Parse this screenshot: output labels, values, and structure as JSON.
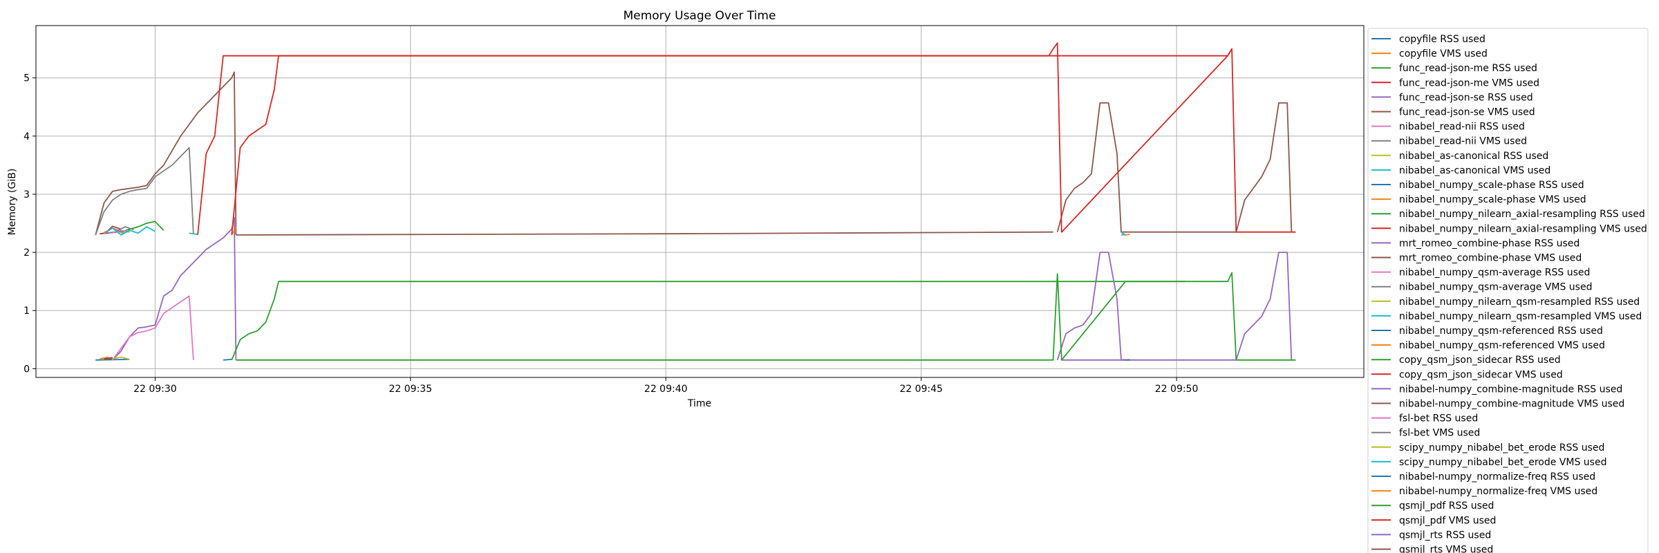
{
  "chart_data": {
    "type": "line",
    "title": "Memory Usage Over Time",
    "xlabel": "Time",
    "ylabel": "Memory (GiB)",
    "xlim": [
      "2022-xx-22 09:27:40",
      "2022-xx-22 09:53:40"
    ],
    "ylim": [
      -0.15,
      5.9
    ],
    "x_ticks": [
      "22 09:30",
      "22 09:35",
      "22 09:40",
      "22 09:45",
      "22 09:50"
    ],
    "y_ticks": [
      "0",
      "1",
      "2",
      "3",
      "4",
      "5"
    ],
    "grid": true,
    "legend_position": "right, outside plot area",
    "series": [
      {
        "name": "copyfile RSS used",
        "color": "#1f77b4",
        "x": [
          "09:28:55",
          "09:29:00"
        ],
        "y": [
          2.32,
          2.33
        ]
      },
      {
        "name": "copyfile VMS used",
        "color": "#ff7f0e",
        "x": [
          "09:29:00",
          "09:29:10",
          "09:29:20"
        ],
        "y": [
          2.34,
          2.42,
          2.36
        ]
      },
      {
        "name": "func_read-json-me RSS used",
        "color": "#2ca02c",
        "x": [
          "09:29:20",
          "09:29:30",
          "09:29:40",
          "09:29:50",
          "09:30:00",
          "09:30:10"
        ],
        "y": [
          2.35,
          2.4,
          2.44,
          2.5,
          2.53,
          2.38
        ]
      },
      {
        "name": "func_read-json-me VMS used",
        "color": "#d62728",
        "x": [
          "09:28:55",
          "09:29:10",
          "09:29:20"
        ],
        "y": [
          2.32,
          2.34,
          2.36
        ]
      },
      {
        "name": "func_read-json-se RSS used",
        "color": "#9467bd",
        "x": [
          "09:29:05",
          "09:29:15",
          "09:29:25"
        ],
        "y": [
          2.33,
          2.36,
          2.34
        ]
      },
      {
        "name": "func_read-json-se VMS used",
        "color": "#8c564b",
        "x": [
          "09:29:05",
          "09:29:10",
          "09:29:20"
        ],
        "y": [
          2.38,
          2.45,
          2.4
        ]
      },
      {
        "name": "nibabel_read-nii RSS used",
        "color": "#e377c2",
        "x": [
          "09:29:10",
          "09:29:20",
          "09:29:30"
        ],
        "y": [
          2.34,
          2.38,
          2.35
        ]
      },
      {
        "name": "nibabel_read-nii VMS used",
        "color": "#7f7f7f",
        "x": [
          "09:29:15",
          "09:29:25",
          "09:29:35"
        ],
        "y": [
          2.37,
          2.44,
          2.39
        ]
      },
      {
        "name": "nibabel_as-canonical RSS used",
        "color": "#bcbd22",
        "x": [
          "09:29:20",
          "09:29:30"
        ],
        "y": [
          2.33,
          2.36
        ]
      },
      {
        "name": "nibabel_as-canonical VMS used",
        "color": "#17becf",
        "x": [
          "09:29:00",
          "09:29:10",
          "09:29:20",
          "09:29:30",
          "09:29:40",
          "09:29:50",
          "09:30:00"
        ],
        "y": [
          2.32,
          2.42,
          2.3,
          2.38,
          2.33,
          2.44,
          2.36
        ]
      },
      {
        "name": "nibabel_numpy_scale-phase RSS used",
        "color": "#1f77b4",
        "x": [
          "09:28:50",
          "09:29:30"
        ],
        "y": [
          0.15,
          0.16
        ]
      },
      {
        "name": "nibabel_numpy_scale-phase VMS used",
        "color": "#ff7f0e",
        "x": [
          "09:28:55",
          "09:29:05"
        ],
        "y": [
          0.17,
          0.2
        ]
      },
      {
        "name": "nibabel_numpy_nilearn_axial-resampling RSS used",
        "color": "#2ca02c",
        "x": [
          "09:29:00",
          "09:29:10"
        ],
        "y": [
          0.16,
          0.18
        ]
      },
      {
        "name": "nibabel_numpy_nilearn_axial-resampling VMS used",
        "color": "#d62728",
        "x": [
          "09:29:00",
          "09:29:10"
        ],
        "y": [
          0.17,
          0.19
        ]
      },
      {
        "name": "mrt_romeo_combine-phase RSS used",
        "color": "#9467bd",
        "x": [
          "09:29:10",
          "09:29:20",
          "09:29:30",
          "09:29:40",
          "09:29:50",
          "09:30:00",
          "09:30:10",
          "09:30:20",
          "09:30:30",
          "09:30:40",
          "09:30:50",
          "09:31:00",
          "09:31:10",
          "09:31:20",
          "09:31:30",
          "09:31:33",
          "09:31:35"
        ],
        "y": [
          0.15,
          0.3,
          0.55,
          0.7,
          0.72,
          0.75,
          1.25,
          1.35,
          1.6,
          1.75,
          1.9,
          2.05,
          2.15,
          2.25,
          2.4,
          2.6,
          0.15
        ]
      },
      {
        "name": "mrt_romeo_combine-phase VMS used",
        "color": "#8c564b",
        "x": [
          "09:28:50",
          "09:29:00",
          "09:29:10",
          "09:29:20",
          "09:29:30",
          "09:29:40",
          "09:29:50",
          "09:30:00",
          "09:30:10",
          "09:30:20",
          "09:30:30",
          "09:30:40",
          "09:30:50",
          "09:31:00",
          "09:31:10",
          "09:31:20",
          "09:31:30",
          "09:31:33",
          "09:31:35"
        ],
        "y": [
          2.3,
          2.85,
          3.05,
          3.08,
          3.1,
          3.12,
          3.15,
          3.35,
          3.5,
          3.75,
          4.0,
          4.2,
          4.4,
          4.55,
          4.7,
          4.85,
          5.0,
          5.1,
          2.3
        ]
      },
      {
        "name": "nibabel_numpy_qsm-average RSS used",
        "color": "#e377c2",
        "x": [
          "09:29:10",
          "09:29:20",
          "09:29:30",
          "09:29:40",
          "09:29:50",
          "09:30:00",
          "09:30:10",
          "09:30:20",
          "09:30:30",
          "09:30:40",
          "09:30:45"
        ],
        "y": [
          0.15,
          0.35,
          0.55,
          0.62,
          0.65,
          0.7,
          0.95,
          1.05,
          1.15,
          1.25,
          0.15
        ]
      },
      {
        "name": "nibabel_numpy_qsm-average VMS used",
        "color": "#7f7f7f",
        "x": [
          "09:28:50",
          "09:29:00",
          "09:29:10",
          "09:29:20",
          "09:29:30",
          "09:29:40",
          "09:29:50",
          "09:30:00",
          "09:30:10",
          "09:30:20",
          "09:30:30",
          "09:30:40",
          "09:30:45"
        ],
        "y": [
          2.3,
          2.7,
          2.9,
          3.0,
          3.05,
          3.08,
          3.1,
          3.3,
          3.4,
          3.5,
          3.65,
          3.8,
          2.32
        ]
      },
      {
        "name": "nibabel_numpy_nilearn_qsm-resampled RSS used",
        "color": "#bcbd22",
        "x": [
          "09:29:10",
          "09:29:20",
          "09:29:30"
        ],
        "y": [
          0.17,
          0.2,
          0.16
        ]
      },
      {
        "name": "nibabel_numpy_nilearn_qsm-resampled VMS used",
        "color": "#17becf",
        "x": [
          "09:30:40",
          "09:30:50"
        ],
        "y": [
          2.33,
          2.31
        ]
      },
      {
        "name": "nibabel_numpy_qsm-referenced RSS used",
        "color": "#1f77b4",
        "x": [
          "09:31:20",
          "09:31:30"
        ],
        "y": [
          0.15,
          0.16
        ]
      },
      {
        "name": "nibabel_numpy_qsm-referenced VMS used",
        "color": "#ff7f0e",
        "x": [
          "09:31:30",
          "09:31:35"
        ],
        "y": [
          2.3,
          2.43
        ]
      },
      {
        "name": "copy_qsm_json_sidecar RSS used",
        "color": "#2ca02c",
        "x": [
          "09:31:30",
          "09:31:40",
          "09:31:50",
          "09:32:00",
          "09:32:10",
          "09:32:20",
          "09:32:25",
          "09:50:00",
          "09:50:10"
        ],
        "y": [
          0.15,
          0.5,
          0.6,
          0.65,
          0.8,
          1.2,
          1.5,
          1.5,
          1.5
        ]
      },
      {
        "name": "copy_qsm_json_sidecar VMS used",
        "color": "#d62728",
        "x": [
          "09:31:30",
          "09:31:40",
          "09:31:50",
          "09:32:00",
          "09:32:10",
          "09:32:20",
          "09:32:25",
          "09:51:00",
          "09:51:05"
        ],
        "y": [
          2.3,
          3.8,
          4.0,
          4.1,
          4.2,
          4.8,
          5.38,
          5.38,
          5.5
        ]
      },
      {
        "name": "nibabel-numpy_combine-magnitude RSS used",
        "color": "#9467bd",
        "x": [
          "09:47:40",
          "09:47:50",
          "09:48:00",
          "09:48:10",
          "09:48:20",
          "09:48:30",
          "09:48:40",
          "09:48:50",
          "09:48:55",
          "09:49:00",
          "09:51:10",
          "09:51:20",
          "09:51:30",
          "09:51:40",
          "09:51:50",
          "09:52:00",
          "09:52:10",
          "09:52:15"
        ],
        "y": [
          0.15,
          0.6,
          0.7,
          0.75,
          0.95,
          2.0,
          2.0,
          1.2,
          0.15,
          0.15,
          0.15,
          0.6,
          0.75,
          0.9,
          1.2,
          2.0,
          2.0,
          0.15
        ]
      },
      {
        "name": "nibabel-numpy_combine-magnitude VMS used",
        "color": "#8c564b",
        "x": [
          "09:47:40",
          "09:47:50",
          "09:48:00",
          "09:48:10",
          "09:48:20",
          "09:48:30",
          "09:48:40",
          "09:48:50",
          "09:48:55",
          "09:49:00",
          "09:51:10",
          "09:51:20",
          "09:51:30",
          "09:51:40",
          "09:51:50",
          "09:52:00",
          "09:52:10",
          "09:52:15"
        ],
        "y": [
          2.35,
          2.9,
          3.1,
          3.2,
          3.35,
          4.57,
          4.57,
          3.7,
          2.35,
          2.35,
          2.35,
          2.9,
          3.1,
          3.3,
          3.6,
          4.57,
          4.57,
          2.35
        ]
      },
      {
        "name": "fsl-bet RSS used",
        "color": "#e377c2",
        "x": [
          "09:48:55",
          "09:49:00"
        ],
        "y": [
          0.15,
          0.16
        ]
      },
      {
        "name": "fsl-bet VMS used",
        "color": "#7f7f7f",
        "x": [
          "09:48:55",
          "09:49:00"
        ],
        "y": [
          2.3,
          2.31
        ]
      },
      {
        "name": "scipy_numpy_nibabel_bet_erode RSS used",
        "color": "#bcbd22",
        "x": [
          "09:49:00",
          "09:49:05"
        ],
        "y": [
          0.15,
          0.16
        ]
      },
      {
        "name": "scipy_numpy_nibabel_bet_erode VMS used",
        "color": "#17becf",
        "x": [
          "09:48:55",
          "09:49:00"
        ],
        "y": [
          2.35,
          2.29
        ]
      },
      {
        "name": "nibabel-numpy_normalize-freq RSS used",
        "color": "#1f77b4",
        "x": [
          "09:49:00",
          "09:49:05"
        ],
        "y": [
          0.15,
          0.15
        ]
      },
      {
        "name": "nibabel-numpy_normalize-freq VMS used",
        "color": "#ff7f0e",
        "x": [
          "09:49:00",
          "09:49:05"
        ],
        "y": [
          2.3,
          2.31
        ]
      },
      {
        "name": "qsmjl_pdf RSS used",
        "color": "#2ca02c",
        "x": [
          "09:31:35",
          "09:40:00",
          "09:47:35",
          "09:47:40",
          "09:47:45",
          "09:49:00",
          "09:51:00",
          "09:51:05",
          "09:51:10",
          "09:52:20"
        ],
        "y": [
          0.15,
          0.15,
          0.15,
          1.63,
          0.15,
          1.5,
          1.5,
          1.65,
          0.15,
          0.15
        ]
      },
      {
        "name": "qsmjl_pdf VMS used",
        "color": "#d62728",
        "x": [
          "09:30:50",
          "09:31:00",
          "09:31:10",
          "09:31:15",
          "09:31:20",
          "09:31:30",
          "09:40:00",
          "09:47:30",
          "09:47:35",
          "09:47:40",
          "09:47:45",
          "09:51:00",
          "09:51:05",
          "09:51:10",
          "09:52:20"
        ],
        "y": [
          2.3,
          3.7,
          4.0,
          4.7,
          5.38,
          5.38,
          5.38,
          5.38,
          5.5,
          5.6,
          2.35,
          5.38,
          5.5,
          2.35,
          2.35
        ]
      },
      {
        "name": "qsmjl_rts RSS used",
        "color": "#9467bd",
        "x": [
          "09:47:45",
          "09:49:00"
        ],
        "y": [
          0.15,
          0.15
        ]
      },
      {
        "name": "qsmjl_rts VMS used",
        "color": "#8c564b",
        "x": [
          "09:31:35",
          "09:40:00",
          "09:47:35"
        ],
        "y": [
          2.3,
          2.32,
          2.35
        ]
      }
    ]
  }
}
